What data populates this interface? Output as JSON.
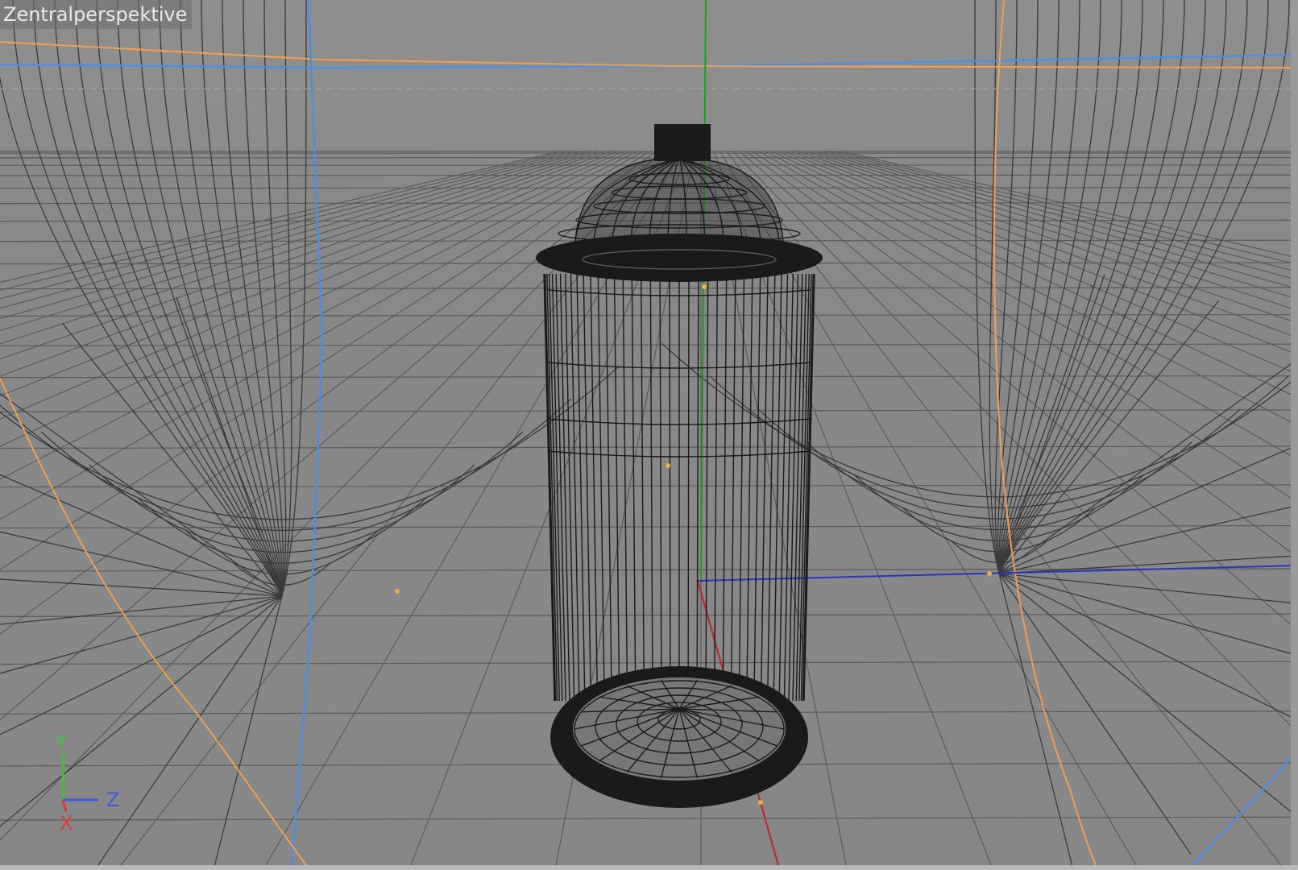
{
  "viewport": {
    "title": "Zentralperspektive",
    "object": "spray-can-wireframe",
    "display_mode": "wireframe"
  },
  "axis_gizmo": {
    "y_label": "Y",
    "z_label": "Z",
    "x_label": "X"
  },
  "colors": {
    "background": "#8a8a8a",
    "grid": "#555555",
    "wireframe": "#1a1a1a",
    "y_axis": "#1f9e1f",
    "x_axis": "#b8262a",
    "z_axis": "#2637b8",
    "light_blue_guide": "#4f8fe0",
    "orange_guide": "#f0a050",
    "gizmo_y": "#3bc43b",
    "gizmo_z": "#3a5bd8",
    "gizmo_x": "#d83a3a"
  }
}
